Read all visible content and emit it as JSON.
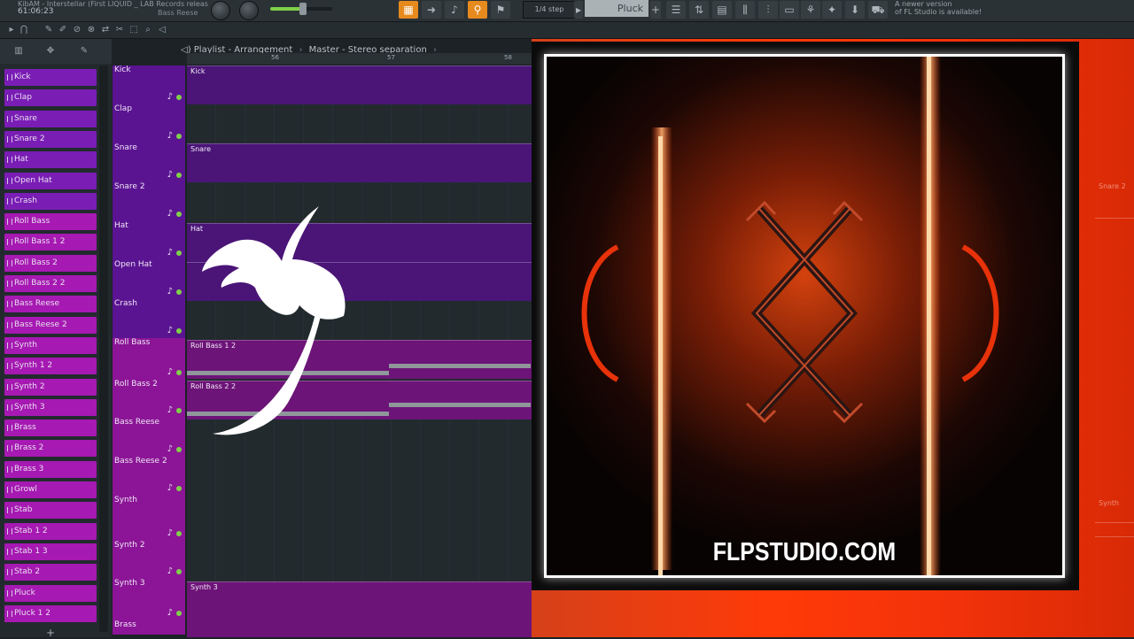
{
  "window": {
    "project_title": "KibAM - Interstellar (First LIQUID _ LAB Records releas",
    "time": "61:06:23",
    "hint_text": "Bass Reese"
  },
  "toolbar": {
    "snap_value": "1/4 step",
    "pattern_name": "Pluck",
    "update_note_line1": "A newer version",
    "update_note_line2": "of FL Studio is available!"
  },
  "playlist": {
    "breadcrumb": [
      "Playlist - Arrangement",
      "Master - Stereo separation"
    ],
    "bars": [
      "56",
      "57",
      "58"
    ],
    "add_label": "+"
  },
  "channels": [
    {
      "label": "Kick",
      "color": "#7a1db5"
    },
    {
      "label": "Clap",
      "color": "#7a1db5"
    },
    {
      "label": "Snare",
      "color": "#7a1db5"
    },
    {
      "label": "Snare 2",
      "color": "#7a1db5"
    },
    {
      "label": "Hat",
      "color": "#7a1db5"
    },
    {
      "label": "Open Hat",
      "color": "#7a1db5"
    },
    {
      "label": "Crash",
      "color": "#7a1db5"
    },
    {
      "label": "Roll Bass",
      "color": "#a619b2"
    },
    {
      "label": "Roll Bass 1 2",
      "color": "#a619b2"
    },
    {
      "label": "Roll Bass 2",
      "color": "#a619b2"
    },
    {
      "label": "Roll Bass 2 2",
      "color": "#a619b2"
    },
    {
      "label": "Bass Reese",
      "color": "#a619b2"
    },
    {
      "label": "Bass Reese 2",
      "color": "#a619b2"
    },
    {
      "label": "Synth",
      "color": "#a619b2"
    },
    {
      "label": "Synth 1 2",
      "color": "#a619b2"
    },
    {
      "label": "Synth 2",
      "color": "#a619b2"
    },
    {
      "label": "Synth 3",
      "color": "#a619b2"
    },
    {
      "label": "Brass",
      "color": "#a619b2"
    },
    {
      "label": "Brass 2",
      "color": "#a619b2"
    },
    {
      "label": "Brass 3",
      "color": "#a619b2"
    },
    {
      "label": "Growl",
      "color": "#a619b2"
    },
    {
      "label": "Stab",
      "color": "#a619b2"
    },
    {
      "label": "Stab 1 2",
      "color": "#a619b2"
    },
    {
      "label": "Stab 1 3",
      "color": "#a619b2"
    },
    {
      "label": "Stab 2",
      "color": "#a619b2"
    },
    {
      "label": "Pluck",
      "color": "#a619b2"
    },
    {
      "label": "Pluck 1 2",
      "color": "#a619b2"
    }
  ],
  "tracks": [
    {
      "label": "Kick",
      "color": "#5a1491"
    },
    {
      "label": "Clap",
      "color": "#5a1491"
    },
    {
      "label": "Snare",
      "color": "#5a1491"
    },
    {
      "label": "Snare 2",
      "color": "#5a1491"
    },
    {
      "label": "Hat",
      "color": "#5a1491"
    },
    {
      "label": "Open Hat",
      "color": "#5a1491"
    },
    {
      "label": "Crash",
      "color": "#5a1491"
    },
    {
      "label": "Roll Bass",
      "color": "#8b1596"
    },
    {
      "label": "Roll Bass 2",
      "color": "#8b1596"
    },
    {
      "label": "Bass Reese",
      "color": "#8b1596"
    },
    {
      "label": "Bass Reese 2",
      "color": "#8b1596"
    },
    {
      "label": "Synth",
      "color": "#8b1596"
    },
    {
      "label": "Synth 2",
      "color": "#8b1596"
    },
    {
      "label": "Synth 3",
      "color": "#8b1596"
    },
    {
      "label": "Brass",
      "color": "#8b1596"
    }
  ],
  "clips": [
    {
      "label": "Kick",
      "color": "#4a1577"
    },
    {
      "label": "Snare",
      "color": "#4a1577"
    },
    {
      "label": "Hat",
      "color": "#4a1577"
    },
    {
      "label": "",
      "color": "#4a1577"
    },
    {
      "label": "Roll Bass 1 2",
      "color": "#6d1478"
    },
    {
      "label": "Roll Bass 2 2",
      "color": "#6d1478"
    },
    {
      "label": "Synth 3",
      "color": "#6d1478"
    }
  ],
  "ghost": {
    "snare_label": "Snare 2",
    "synth_label": "Synth"
  },
  "cover": {
    "watermark": "FLPSTUDIO.COM"
  }
}
